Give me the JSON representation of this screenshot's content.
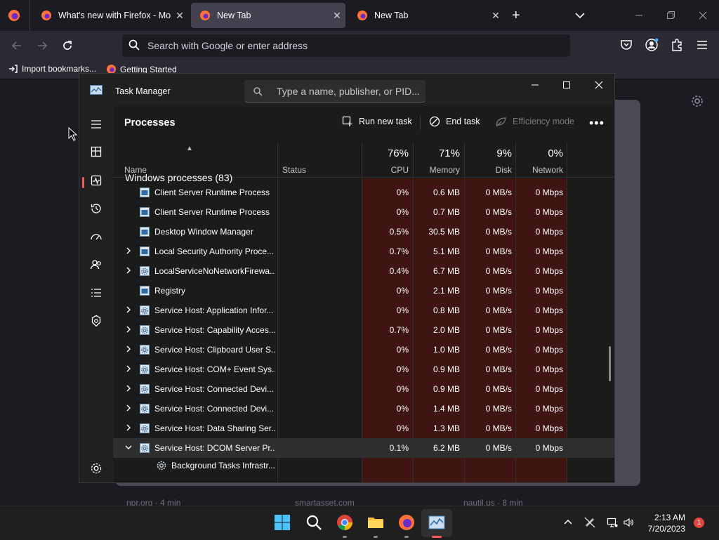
{
  "browser": {
    "tabs": [
      {
        "title": "What's new with Firefox - More",
        "selected": false
      },
      {
        "title": "New Tab",
        "selected": true
      },
      {
        "title": "New Tab",
        "selected": false
      }
    ],
    "address_placeholder": "Search with Google or enter address",
    "bookmarks": [
      {
        "label": "Import bookmarks..."
      },
      {
        "label": "Getting Started"
      }
    ],
    "page_footer": [
      "npr.org · 4 min",
      "smartasset.com",
      "nautil.us · 8 min"
    ]
  },
  "task_manager": {
    "app_name": "Task Manager",
    "search_placeholder": "Type a name, publisher, or PID...",
    "section_title": "Processes",
    "toolbar": {
      "run_new_task": "Run new task",
      "end_task": "End task",
      "efficiency_mode": "Efficiency mode"
    },
    "columns": {
      "name": "Name",
      "status": "Status",
      "cpu": {
        "pct": "76%",
        "label": "CPU"
      },
      "memory": {
        "pct": "71%",
        "label": "Memory"
      },
      "disk": {
        "pct": "9%",
        "label": "Disk"
      },
      "network": {
        "pct": "0%",
        "label": "Network"
      }
    },
    "group_label": "Windows processes (83)",
    "rows": [
      {
        "name": "Client Server Runtime Process",
        "expandable": false,
        "icon": "window-icon",
        "cpu": "0%",
        "memory": "0.6 MB",
        "disk": "0 MB/s",
        "network": "0 Mbps"
      },
      {
        "name": "Client Server Runtime Process",
        "expandable": false,
        "icon": "window-icon",
        "cpu": "0%",
        "memory": "0.7 MB",
        "disk": "0 MB/s",
        "network": "0 Mbps"
      },
      {
        "name": "Desktop Window Manager",
        "expandable": false,
        "icon": "window-icon",
        "cpu": "0.5%",
        "memory": "30.5 MB",
        "disk": "0 MB/s",
        "network": "0 Mbps"
      },
      {
        "name": "Local Security Authority Proce...",
        "expandable": true,
        "icon": "window-icon",
        "cpu": "0.7%",
        "memory": "5.1 MB",
        "disk": "0 MB/s",
        "network": "0 Mbps"
      },
      {
        "name": "LocalServiceNoNetworkFirewa...",
        "expandable": true,
        "icon": "gear-window-icon",
        "cpu": "0.4%",
        "memory": "6.7 MB",
        "disk": "0 MB/s",
        "network": "0 Mbps"
      },
      {
        "name": "Registry",
        "expandable": false,
        "icon": "window-icon",
        "cpu": "0%",
        "memory": "2.1 MB",
        "disk": "0 MB/s",
        "network": "0 Mbps"
      },
      {
        "name": "Service Host: Application Infor...",
        "expandable": true,
        "icon": "gear-window-icon",
        "cpu": "0%",
        "memory": "0.8 MB",
        "disk": "0 MB/s",
        "network": "0 Mbps"
      },
      {
        "name": "Service Host: Capability Acces...",
        "expandable": true,
        "icon": "gear-window-icon",
        "cpu": "0.7%",
        "memory": "2.0 MB",
        "disk": "0 MB/s",
        "network": "0 Mbps"
      },
      {
        "name": "Service Host: Clipboard User S...",
        "expandable": true,
        "icon": "gear-window-icon",
        "cpu": "0%",
        "memory": "1.0 MB",
        "disk": "0 MB/s",
        "network": "0 Mbps"
      },
      {
        "name": "Service Host: COM+ Event Sys...",
        "expandable": true,
        "icon": "gear-window-icon",
        "cpu": "0%",
        "memory": "0.9 MB",
        "disk": "0 MB/s",
        "network": "0 Mbps"
      },
      {
        "name": "Service Host: Connected Devi...",
        "expandable": true,
        "icon": "gear-window-icon",
        "cpu": "0%",
        "memory": "0.9 MB",
        "disk": "0 MB/s",
        "network": "0 Mbps"
      },
      {
        "name": "Service Host: Connected Devi...",
        "expandable": true,
        "icon": "gear-window-icon",
        "cpu": "0%",
        "memory": "1.4 MB",
        "disk": "0 MB/s",
        "network": "0 Mbps"
      },
      {
        "name": "Service Host: Data Sharing Ser...",
        "expandable": true,
        "icon": "gear-window-icon",
        "cpu": "0%",
        "memory": "1.3 MB",
        "disk": "0 MB/s",
        "network": "0 Mbps"
      },
      {
        "name": "Service Host: DCOM Server Pr...",
        "expandable": true,
        "expanded": true,
        "icon": "gear-window-icon",
        "cpu": "0.1%",
        "memory": "6.2 MB",
        "disk": "0 MB/s",
        "network": "0 Mbps"
      },
      {
        "name": "Background Tasks Infrastr...",
        "expandable": false,
        "child": true,
        "icon": "gear-icon",
        "cpu": "",
        "memory": "",
        "disk": "",
        "network": ""
      }
    ]
  },
  "taskbar": {
    "time": "2:13 AM",
    "date": "7/20/2023",
    "notification_count": "1"
  },
  "colors": {
    "heat": "#3e1512",
    "accent_red": "#f35a5a",
    "firefox_orange": "#ff7139"
  }
}
